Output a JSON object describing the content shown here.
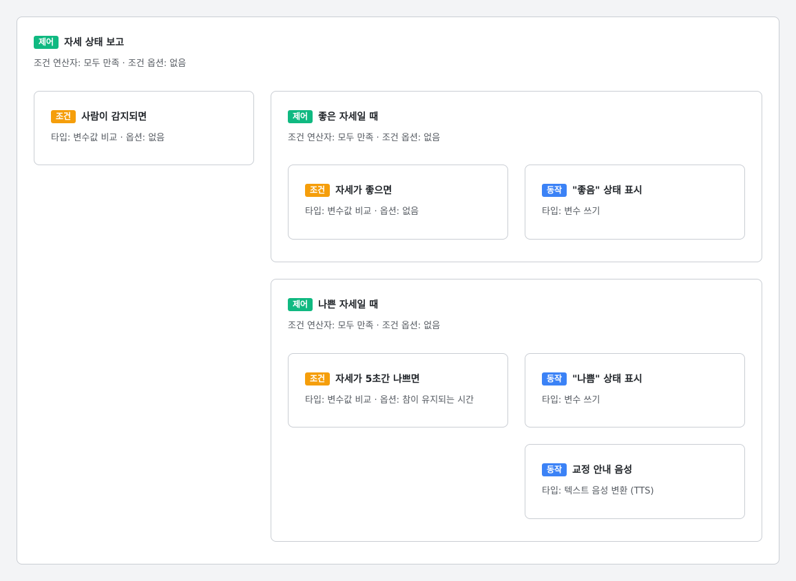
{
  "badges": {
    "control": "제어",
    "condition": "조건",
    "action": "동작"
  },
  "colors": {
    "control": "#10b981",
    "condition": "#f59e0b",
    "action": "#3b82f6",
    "border": "#c9cdd3",
    "background": "#f3f4f6"
  },
  "root": {
    "title": "자세 상태 보고",
    "subtitle": "조건 연산자: 모두 만족 · 조건 옵션: 없음"
  },
  "person_detected": {
    "title": "사람이 감지되면",
    "subtitle": "타입: 변수값 비교 · 옵션: 없음"
  },
  "good_posture": {
    "title": "좋은 자세일 때",
    "subtitle": "조건 연산자: 모두 만족 · 조건 옵션: 없음",
    "condition": {
      "title": "자세가 좋으면",
      "subtitle": "타입: 변수값 비교 · 옵션: 없음"
    },
    "action": {
      "title": "\"좋음\" 상태 표시",
      "subtitle": "타입: 변수 쓰기"
    }
  },
  "bad_posture": {
    "title": "나쁜 자세일 때",
    "subtitle": "조건 연산자: 모두 만족 · 조건 옵션: 없음",
    "condition": {
      "title": "자세가 5초간 나쁘면",
      "subtitle": "타입: 변수값 비교 · 옵션: 참이 유지되는 시간"
    },
    "action_status": {
      "title": "\"나쁨\" 상태 표시",
      "subtitle": "타입: 변수 쓰기"
    },
    "action_voice": {
      "title": "교정 안내 음성",
      "subtitle": "타입: 텍스트 음성 변환 (TTS)"
    }
  }
}
